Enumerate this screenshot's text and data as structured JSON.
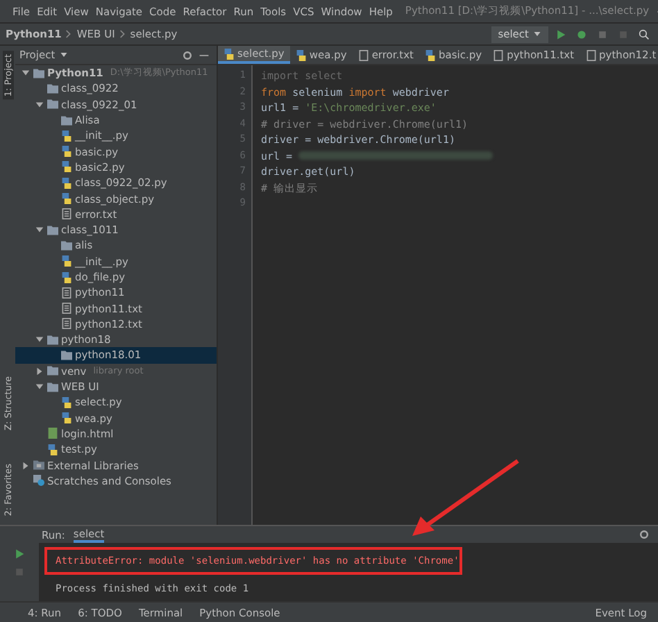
{
  "window": {
    "title": "Python11 [D:\\学习视频\\Python11] - ...\\select.py",
    "menu": [
      "File",
      "Edit",
      "View",
      "Navigate",
      "Code",
      "Refactor",
      "Run",
      "Tools",
      "VCS",
      "Window",
      "Help"
    ]
  },
  "navbar": {
    "crumbs": [
      "Python11",
      "WEB UI",
      "select.py"
    ],
    "run_config": "select"
  },
  "side_stripe": {
    "top": "1: Project",
    "middle": "Z: Structure",
    "bottom": "2: Favorites"
  },
  "project_panel": {
    "title": "Project",
    "tree": [
      {
        "label": "Python11",
        "hint": "D:\\学习视频\\Python11",
        "kind": "folder",
        "bold": true,
        "expanded": true,
        "selected": false,
        "children": [
          {
            "label": "class_0922",
            "kind": "folder",
            "selected": false
          },
          {
            "label": "class_0922_01",
            "kind": "folder",
            "expanded": true,
            "selected": false,
            "children": [
              {
                "label": "Alisa",
                "kind": "folder",
                "selected": false
              },
              {
                "label": "__init__.py",
                "kind": "py",
                "selected": false
              },
              {
                "label": "basic.py",
                "kind": "py",
                "selected": false
              },
              {
                "label": "basic2.py",
                "kind": "py",
                "selected": false
              },
              {
                "label": "class_0922_02.py",
                "kind": "py",
                "selected": false
              },
              {
                "label": "class_object.py",
                "kind": "py",
                "selected": false
              },
              {
                "label": "error.txt",
                "kind": "txt",
                "selected": false
              }
            ]
          },
          {
            "label": "class_1011",
            "kind": "folder",
            "expanded": true,
            "selected": false,
            "children": [
              {
                "label": "alis",
                "kind": "folder",
                "selected": false
              },
              {
                "label": "__init__.py",
                "kind": "py",
                "selected": false
              },
              {
                "label": "do_file.py",
                "kind": "py",
                "selected": false
              },
              {
                "label": "python11",
                "kind": "txt",
                "selected": false
              },
              {
                "label": "python11.txt",
                "kind": "txt",
                "selected": false
              },
              {
                "label": "python12.txt",
                "kind": "txt",
                "selected": false
              }
            ]
          },
          {
            "label": "python18",
            "kind": "folder",
            "expanded": true,
            "selected": false,
            "children": [
              {
                "label": "python18.01",
                "kind": "folder",
                "selected": true
              }
            ]
          },
          {
            "label": "venv",
            "hint": "library root",
            "kind": "folder",
            "expanded": false,
            "selected": false
          },
          {
            "label": "WEB UI",
            "kind": "folder",
            "expanded": true,
            "selected": false,
            "children": [
              {
                "label": "select.py",
                "kind": "py",
                "selected": false
              },
              {
                "label": "wea.py",
                "kind": "py",
                "selected": false
              }
            ]
          },
          {
            "label": "login.html",
            "kind": "html",
            "selected": false
          },
          {
            "label": "test.py",
            "kind": "py",
            "selected": false
          }
        ]
      },
      {
        "label": "External Libraries",
        "kind": "lib",
        "expanded": false,
        "selected": false
      },
      {
        "label": "Scratches and Consoles",
        "kind": "scratch",
        "selected": false
      }
    ]
  },
  "tabs": [
    {
      "label": "select.py",
      "kind": "py",
      "selected": true
    },
    {
      "label": "wea.py",
      "kind": "py",
      "selected": false
    },
    {
      "label": "error.txt",
      "kind": "txt",
      "selected": false
    },
    {
      "label": "basic.py",
      "kind": "py",
      "selected": false
    },
    {
      "label": "python11.txt",
      "kind": "txt",
      "selected": false
    },
    {
      "label": "python12.t",
      "kind": "txt",
      "selected": false
    }
  ],
  "editor": {
    "lines": [
      {
        "num": "1",
        "tokens": [
          {
            "text": "import select",
            "kind": "unused"
          }
        ]
      },
      {
        "num": "2",
        "tokens": [
          {
            "text": "from",
            "kind": "kw"
          },
          {
            "text": " selenium ",
            "kind": "plain"
          },
          {
            "text": "import",
            "kind": "kw"
          },
          {
            "text": " webdriver",
            "kind": "plain"
          }
        ]
      },
      {
        "num": "3",
        "tokens": [
          {
            "text": "url1 = ",
            "kind": "plain"
          },
          {
            "text": "'E:\\chromedriver.exe'",
            "kind": "str"
          }
        ]
      },
      {
        "num": "4",
        "tokens": [
          {
            "text": "# driver = webdriver.Chrome(url1)",
            "kind": "comment"
          }
        ]
      },
      {
        "num": "5",
        "tokens": [
          {
            "text": "driver = webdriver.Chrome(url1)",
            "kind": "plain"
          }
        ]
      },
      {
        "num": "6",
        "tokens": [
          {
            "text": "url = ",
            "kind": "plain"
          }
        ],
        "redacted": true
      },
      {
        "num": "7",
        "tokens": [
          {
            "text": "driver.get(url)",
            "kind": "plain"
          }
        ]
      },
      {
        "num": "8",
        "tokens": [
          {
            "text": "# 输出显示",
            "kind": "comment"
          }
        ]
      },
      {
        "num": "9"
      }
    ]
  },
  "run_panel": {
    "label": "Run:",
    "config": "select",
    "output": [
      {
        "text": "AttributeError: module 'selenium.webdriver' has no attribute 'Chrome'",
        "kind": "error"
      },
      {
        "text": "Process finished with exit code 1",
        "kind": "info"
      }
    ]
  },
  "bottom_bar": {
    "tools": [
      "4: Run",
      "6: TODO",
      "Terminal",
      "Python Console"
    ],
    "event_log": "Event Log"
  }
}
